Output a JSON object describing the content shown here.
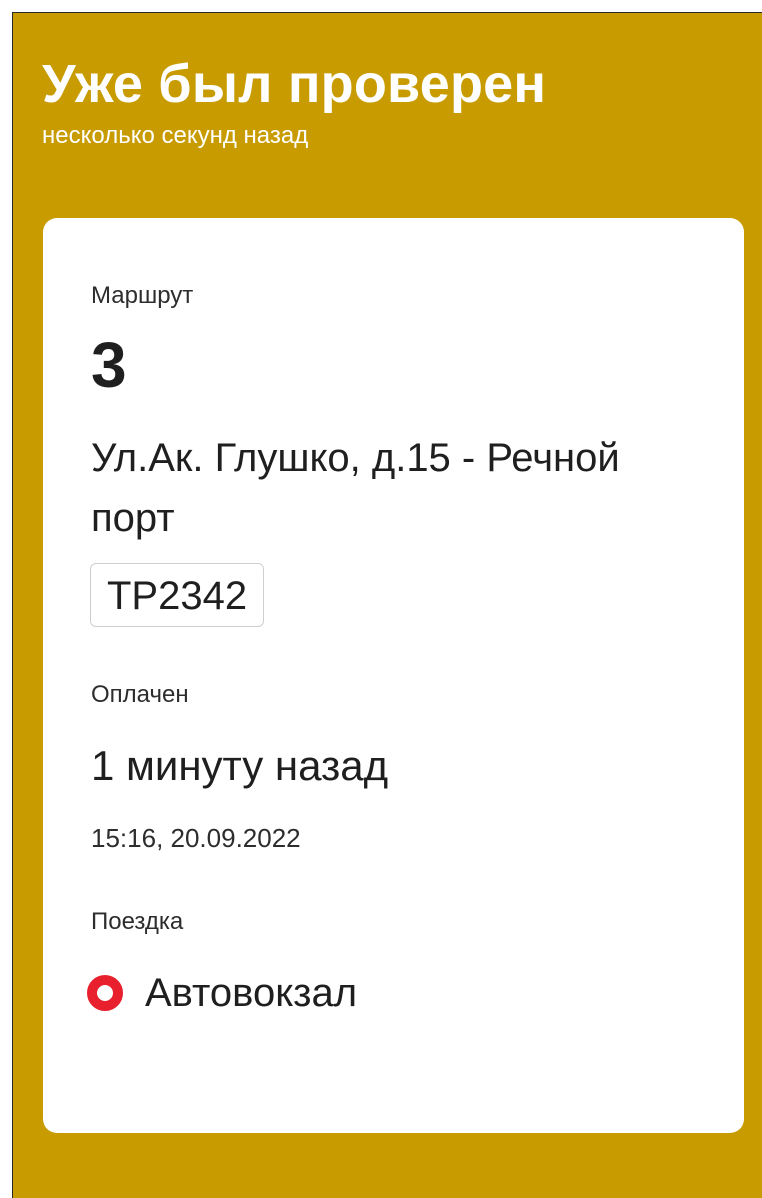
{
  "header": {
    "title": "Уже был проверен",
    "subtitle": "несколько секунд назад"
  },
  "route": {
    "label": "Маршрут",
    "number": "3",
    "name": "Ул.Ак. Глушко, д.15 - Речной порт",
    "vehicle": "ТР2342"
  },
  "payment": {
    "label": "Оплачен",
    "relative": "1 минуту назад",
    "datetime": "15:16, 20.09.2022"
  },
  "trip": {
    "label": "Поездка",
    "stop": "Автовокзал",
    "stop_icon": "stop-marker-icon"
  },
  "colors": {
    "background": "#C89B00",
    "card": "#FFFFFF",
    "marker": "#E8202E"
  }
}
